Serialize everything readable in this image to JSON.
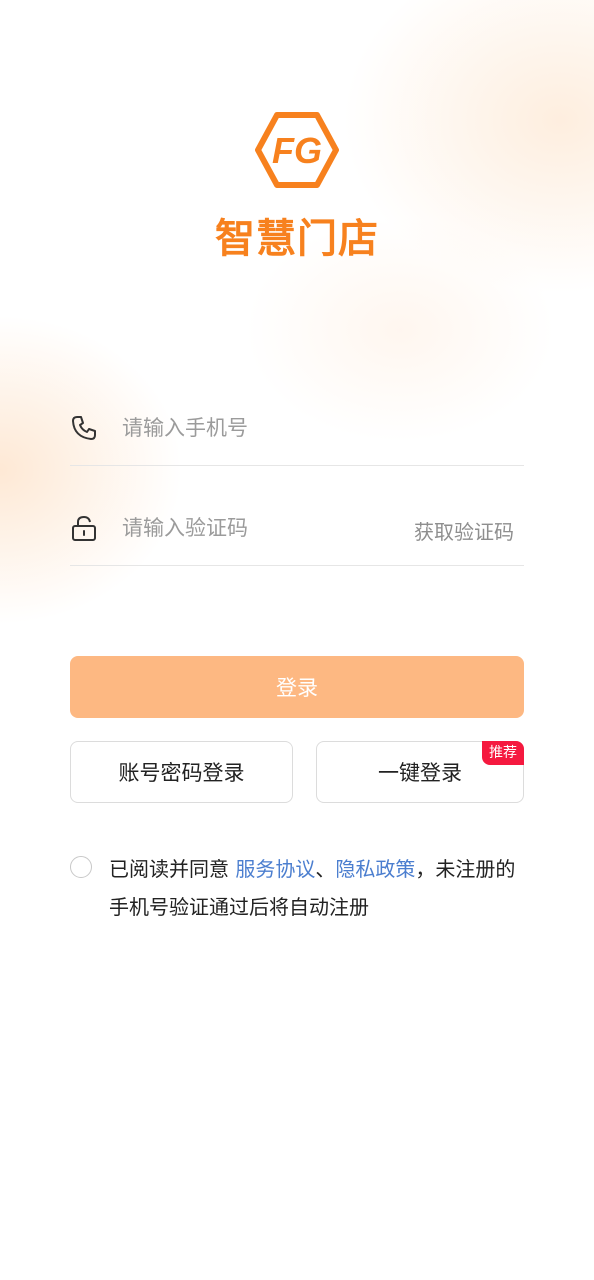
{
  "brand": {
    "logo_letters": "FG",
    "app_name": "智慧门店",
    "accent_color": "#f7811e"
  },
  "phone_field": {
    "icon": "phone-icon",
    "placeholder": "请输入手机号"
  },
  "code_field": {
    "icon": "lock-icon",
    "placeholder": "请输入验证码",
    "get_code_label": "获取验证码"
  },
  "login_button": {
    "label": "登录",
    "color": "#fdb882"
  },
  "alt_login": {
    "password_label": "账号密码登录",
    "one_click_label": "一键登录",
    "badge": "推荐",
    "badge_color": "#f5193f"
  },
  "agreement": {
    "prefix": "已阅读并同意 ",
    "service_link": "服务协议",
    "separator": "、",
    "privacy_link": "隐私政策",
    "suffix": "，未注册的手机号验证通过后将自动注册",
    "link_color": "#4b7ecf"
  }
}
